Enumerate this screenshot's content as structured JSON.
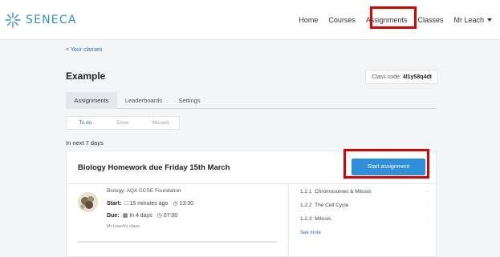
{
  "app": {
    "brand": "SENECA",
    "brand_color": "#2f8fd8",
    "logo_icon": "seneca-asterisk-logo-icon"
  },
  "nav": {
    "items": [
      "Home",
      "Courses",
      "Assignments",
      "Classes"
    ],
    "user": "Mr Leach",
    "user_menu_icon": "caret-down-icon",
    "active": "Assignments"
  },
  "breadcrumb": {
    "back_label": "< Your classes"
  },
  "class": {
    "title": "Example",
    "code_label": "Class code:",
    "code_value": "4l1y58q4dt"
  },
  "tabs": [
    "Assignments",
    "Leaderboards",
    "Settings"
  ],
  "filters": [
    "To do",
    "Done",
    "Missed"
  ],
  "section_label": "In next 7 days",
  "assignment": {
    "title": "Biology Homework due Friday 15th March",
    "start_label": "Start assignment",
    "course": "Biology: AQA GCSE Foundation",
    "start_label_text": "Start:",
    "start_ago": "15 minutes ago",
    "start_time": "13:30",
    "due_label_text": "Due:",
    "due_in": "In 4 days",
    "due_time": "07:00",
    "owner": "Mr Leach's class",
    "topics": [
      {
        "num": "1.2.1",
        "name": "Chromosomes & Mitosis"
      },
      {
        "num": "1.2.2",
        "name": "The Cell Cycle"
      },
      {
        "num": "1.2.3",
        "name": "Mitosis"
      }
    ],
    "see_more": "See more"
  },
  "colors": {
    "accent": "#2f8fd8",
    "highlight": "#e00000"
  }
}
